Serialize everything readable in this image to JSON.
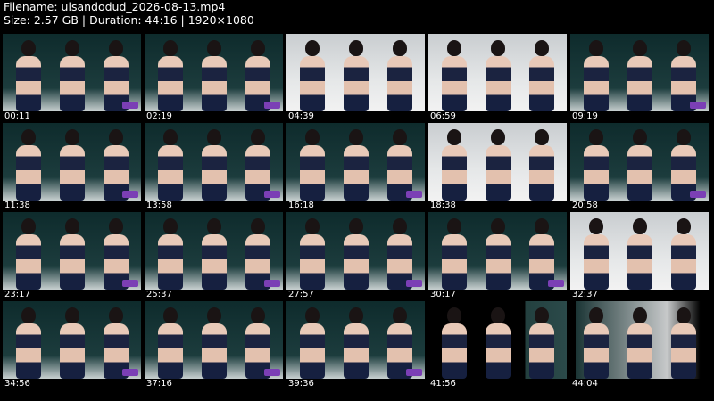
{
  "header": {
    "filename": "Filename: ulsandodud_2026-08-13.mp4",
    "info": "Size: 2.57 GB | Duration: 44:16 | 1920×1080"
  },
  "thumbnails": [
    {
      "time": "00:11",
      "style": "dark"
    },
    {
      "time": "02:19",
      "style": "dark"
    },
    {
      "time": "04:39",
      "style": "light"
    },
    {
      "time": "06:59",
      "style": "light"
    },
    {
      "time": "09:19",
      "style": "dark"
    },
    {
      "time": "11:38",
      "style": "dark"
    },
    {
      "time": "13:58",
      "style": "dark"
    },
    {
      "time": "16:18",
      "style": "dark"
    },
    {
      "time": "18:38",
      "style": "light"
    },
    {
      "time": "20:58",
      "style": "dark"
    },
    {
      "time": "23:17",
      "style": "dark"
    },
    {
      "time": "25:37",
      "style": "dark"
    },
    {
      "time": "27:57",
      "style": "dark"
    },
    {
      "time": "30:17",
      "style": "dark"
    },
    {
      "time": "32:37",
      "style": "light"
    },
    {
      "time": "34:56",
      "style": "dark"
    },
    {
      "time": "37:16",
      "style": "dark"
    },
    {
      "time": "39:36",
      "style": "dark"
    },
    {
      "time": "41:56",
      "style": "partial"
    },
    {
      "time": "44:04",
      "style": "partial2"
    }
  ]
}
